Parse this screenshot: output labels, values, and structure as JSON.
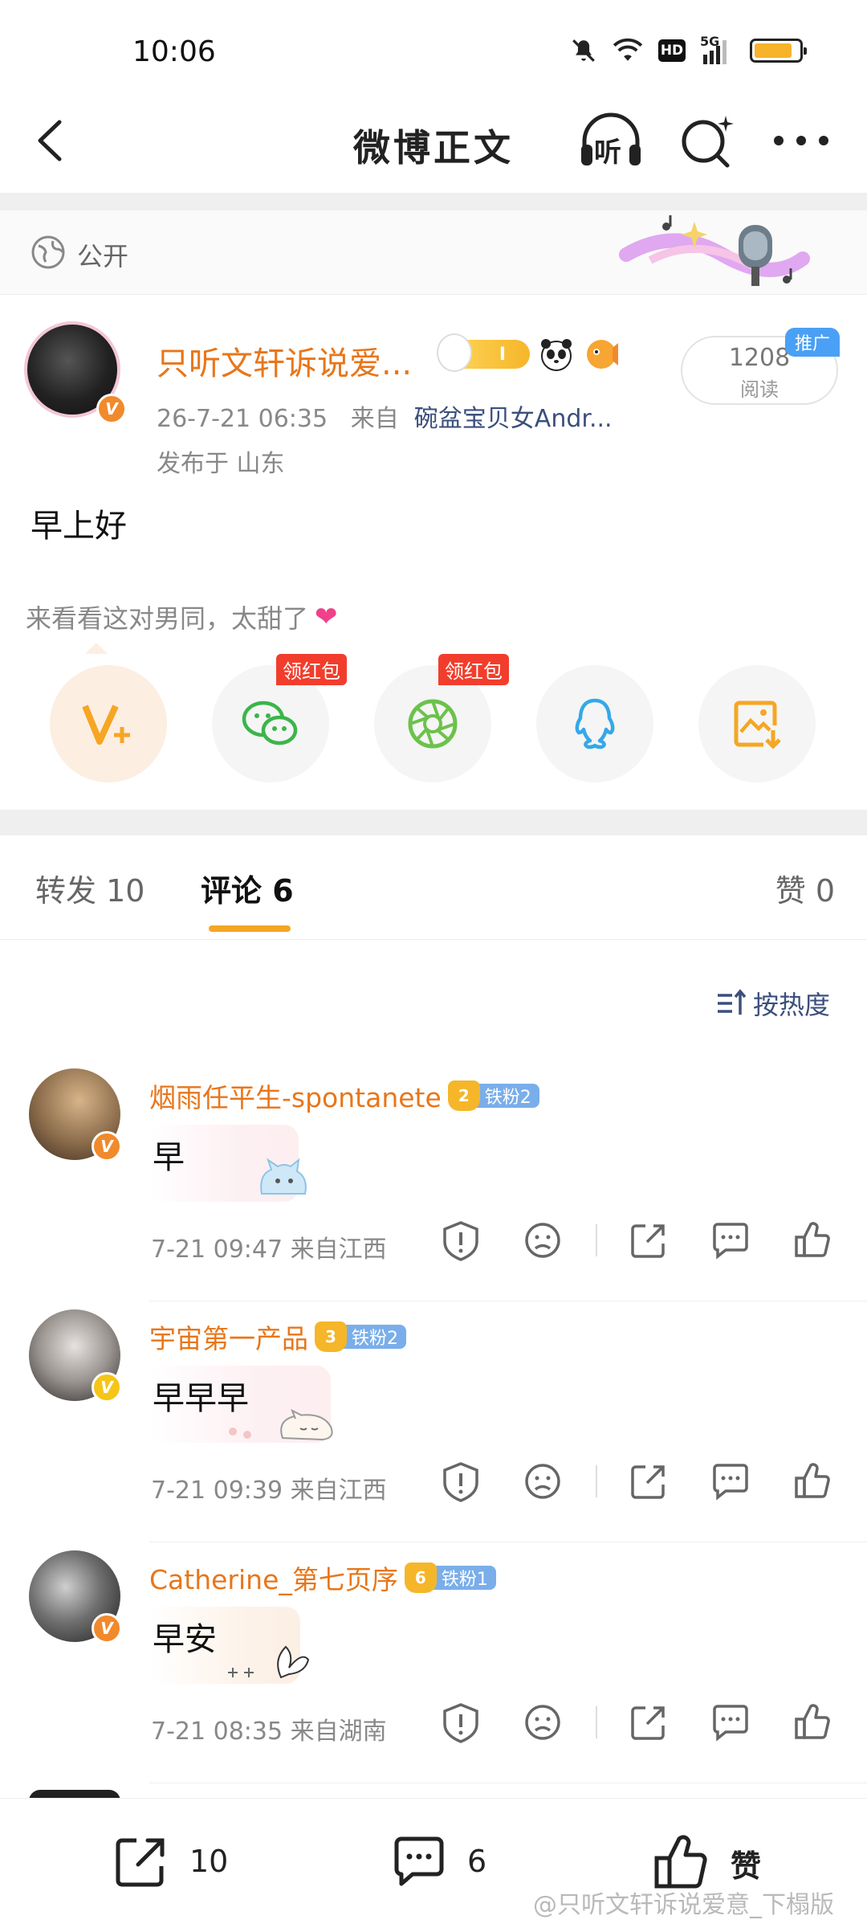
{
  "status_bar": {
    "time": "10:06",
    "network": "5G",
    "hd": "HD",
    "battery_level": 0.85
  },
  "nav": {
    "title": "微博正文",
    "listen_label": "听"
  },
  "visibility": {
    "label": "公开"
  },
  "post": {
    "author": "只听文轩诉说爱...",
    "level": "I",
    "timestamp": "26-7-21 06:35",
    "source_prefix": "来自",
    "source": "碗盆宝贝女Andr...",
    "location": "发布于 山东",
    "read_count": "1208",
    "read_label": "阅读",
    "promo_tag": "推广",
    "text": "早上好",
    "share_tip": "来看看这对男同，太甜了",
    "share_tip_icon": "heart-icon"
  },
  "share_options": [
    {
      "name": "vplus",
      "tag": ""
    },
    {
      "name": "wechat",
      "tag": "领红包"
    },
    {
      "name": "moments",
      "tag": "领红包"
    },
    {
      "name": "qq",
      "tag": ""
    },
    {
      "name": "save-image",
      "tag": ""
    }
  ],
  "tabs": [
    {
      "label": "转发 10",
      "active": false
    },
    {
      "label": "评论 6",
      "active": true
    },
    {
      "label": "赞 0",
      "active": false
    }
  ],
  "sort": {
    "label": "按热度"
  },
  "comments": [
    {
      "author": "烟雨任平生-spontanete",
      "fan_level": "2",
      "fan_label": "铁粉2",
      "text": "早",
      "time": "7-21 09:47",
      "location": "来自江西",
      "badge_color": "#f08a2c"
    },
    {
      "author": "宇宙第一产品",
      "fan_level": "3",
      "fan_label": "铁粉2",
      "text": "早早早",
      "time": "7-21 09:39",
      "location": "来自江西",
      "badge_color": "#f5c518"
    },
    {
      "author": "Catherine_第七页序",
      "fan_level": "6",
      "fan_label": "铁粉1",
      "text": "早安",
      "time": "7-21 08:35",
      "location": "来自湖南",
      "badge_color": "#f08a2c"
    }
  ],
  "bottom_bar": {
    "repost_count": "10",
    "comment_count": "6",
    "like_label": "赞"
  },
  "watermark": "@只听文轩诉说爱意_下榻版",
  "colors": {
    "accent": "#e8761a",
    "tab_indicator": "#f5a623",
    "source": "#3c4f7c",
    "red_tag": "#f23d2c"
  }
}
